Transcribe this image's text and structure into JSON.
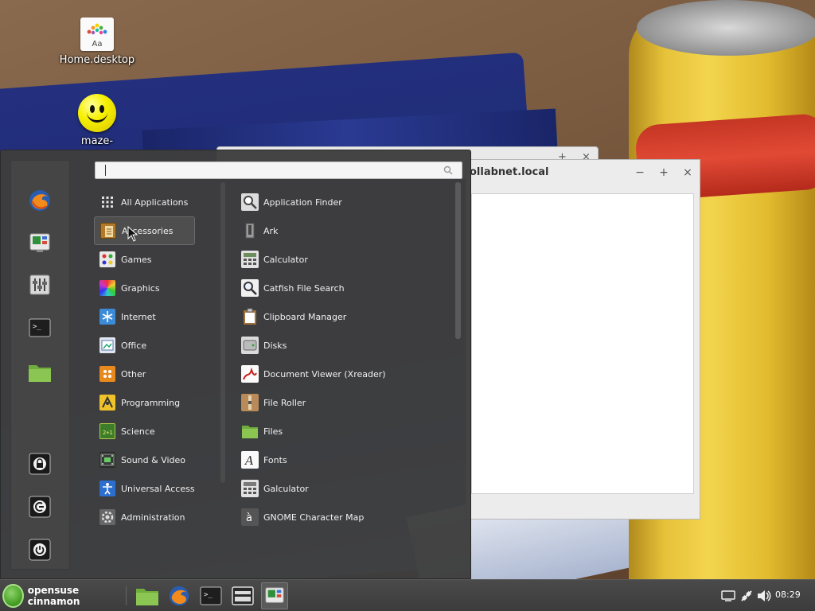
{
  "desktop": {
    "icons": [
      {
        "label": "Home.desktop",
        "glyph": "Aa"
      },
      {
        "label": "maze-"
      }
    ]
  },
  "windows": {
    "main_title": "ollabnet.local",
    "minimize": "−",
    "maximize": "+",
    "close": "×"
  },
  "menu": {
    "search": {
      "value": "",
      "placeholder": ""
    },
    "categories": [
      {
        "label": "All Applications",
        "icon": "grid-icon"
      },
      {
        "label": "Accessories",
        "icon": "accessories-icon",
        "active": true
      },
      {
        "label": "Games",
        "icon": "games-icon"
      },
      {
        "label": "Graphics",
        "icon": "graphics-icon"
      },
      {
        "label": "Internet",
        "icon": "internet-icon"
      },
      {
        "label": "Office",
        "icon": "office-icon"
      },
      {
        "label": "Other",
        "icon": "other-icon"
      },
      {
        "label": "Programming",
        "icon": "programming-icon"
      },
      {
        "label": "Science",
        "icon": "science-icon"
      },
      {
        "label": "Sound & Video",
        "icon": "sound-video-icon"
      },
      {
        "label": "Universal Access",
        "icon": "universal-access-icon"
      },
      {
        "label": "Administration",
        "icon": "administration-icon"
      }
    ],
    "apps": [
      {
        "label": "Application Finder",
        "icon": "app-finder-icon"
      },
      {
        "label": "Ark",
        "icon": "ark-icon"
      },
      {
        "label": "Calculator",
        "icon": "calculator-icon"
      },
      {
        "label": "Catfish File Search",
        "icon": "catfish-icon"
      },
      {
        "label": "Clipboard Manager",
        "icon": "clipboard-icon"
      },
      {
        "label": "Disks",
        "icon": "disks-icon"
      },
      {
        "label": "Document Viewer (Xreader)",
        "icon": "document-viewer-icon"
      },
      {
        "label": "File Roller",
        "icon": "file-roller-icon"
      },
      {
        "label": "Files",
        "icon": "folder-icon"
      },
      {
        "label": "Fonts",
        "icon": "fonts-icon"
      },
      {
        "label": "Galculator",
        "icon": "galculator-icon"
      },
      {
        "label": "GNOME Character Map",
        "icon": "character-map-icon"
      }
    ],
    "favorites": [
      "firefox-icon",
      "system-monitor-icon",
      "settings-icon",
      "terminal-icon",
      "folder-icon"
    ],
    "session": [
      "lock-icon",
      "logout-icon",
      "power-icon"
    ]
  },
  "panel": {
    "menu_label": "opensuse cinnamon",
    "launchers": [
      "folder-icon",
      "firefox-icon",
      "terminal-icon",
      "window-switcher-icon",
      "system-monitor-icon"
    ],
    "tray": [
      "display-icon",
      "network-icon",
      "volume-icon"
    ],
    "clock": "08:29"
  },
  "colors": {
    "menu_bg": "#3e3e3e",
    "panel_bg": "#424242",
    "accent_green": "#4aa328"
  }
}
